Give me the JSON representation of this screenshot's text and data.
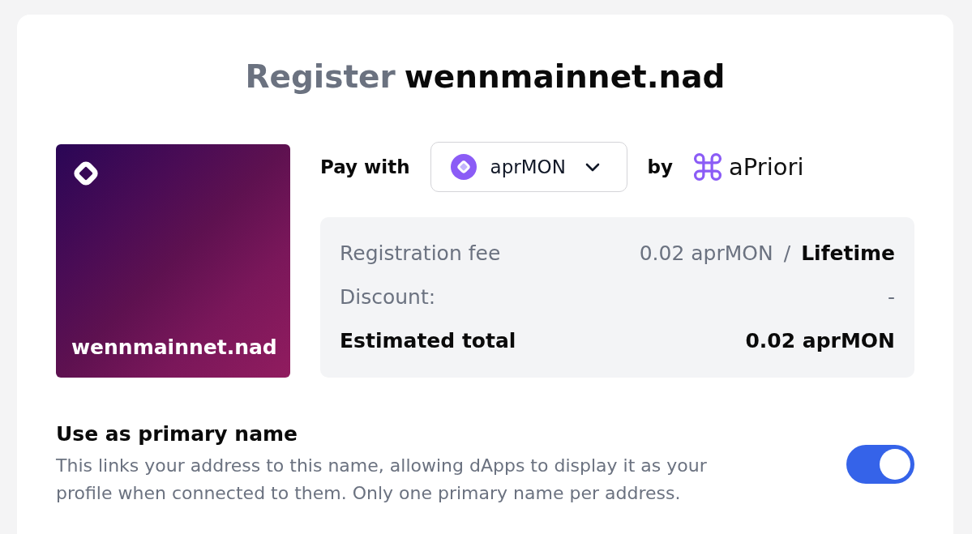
{
  "title": {
    "verb": "Register",
    "name": "wennmainnet.nad"
  },
  "preview_card": {
    "name": "wennmainnet.nad"
  },
  "payment": {
    "label": "Pay with",
    "token": {
      "symbol": "aprMON"
    },
    "by_label": "by",
    "provider": "aPriori"
  },
  "fees": {
    "rows": [
      {
        "kind": "fee",
        "label": "Registration fee",
        "value": "0.02 aprMON",
        "separator": "/",
        "period": "Lifetime"
      },
      {
        "kind": "plain",
        "label": "Discount:",
        "value": "-"
      },
      {
        "kind": "total",
        "label": "Estimated total",
        "value": "0.02 aprMON"
      }
    ]
  },
  "primary_name": {
    "title": "Use as primary name",
    "description": "This links your address to this name, allowing dApps to display it as your profile when connected to them. Only one primary name per address.",
    "on": true
  }
}
